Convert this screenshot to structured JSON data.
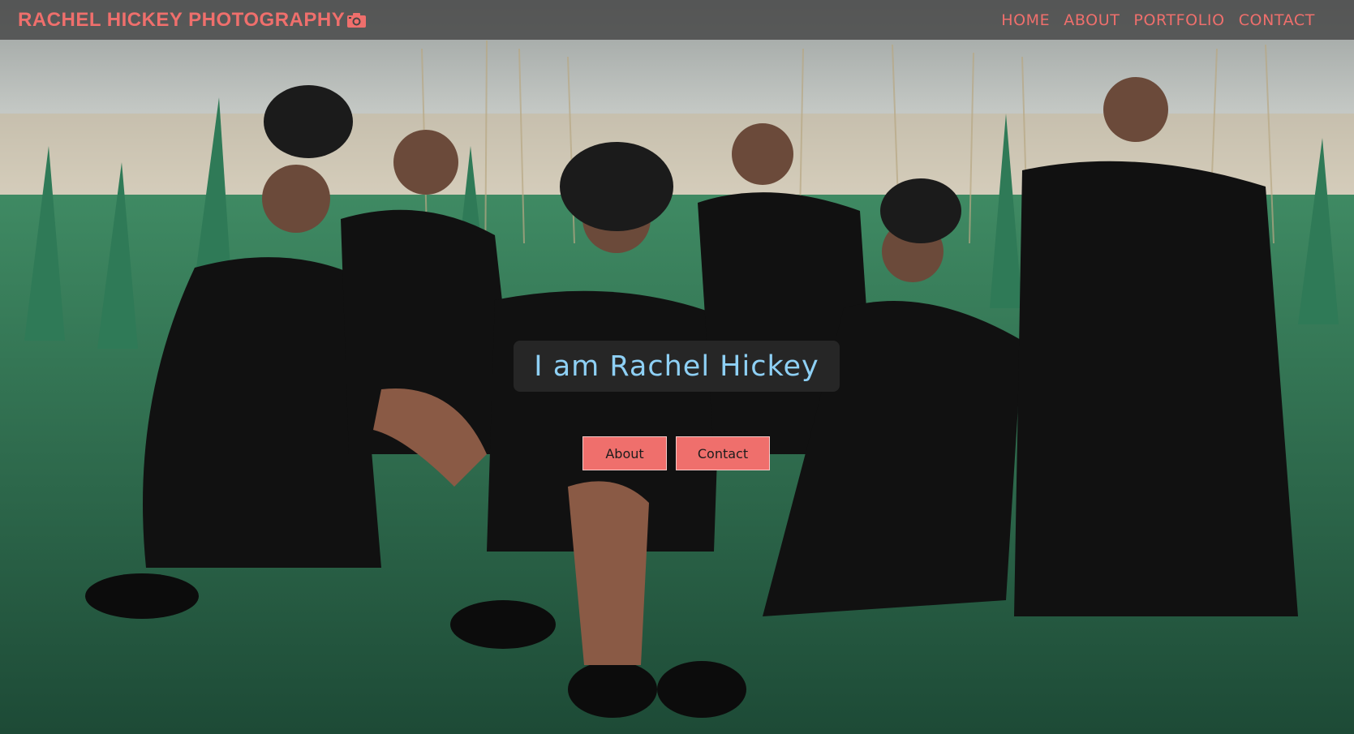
{
  "header": {
    "brand": "RACHEL HICKEY PHOTOGRAPHY",
    "brand_icon": "camera-icon",
    "nav": [
      {
        "label": "HOME"
      },
      {
        "label": "ABOUT"
      },
      {
        "label": "PORTFOLIO"
      },
      {
        "label": "CONTACT"
      }
    ]
  },
  "hero": {
    "title": "I am Rachel Hickey",
    "buttons": {
      "about": "About",
      "contact": "Contact"
    }
  },
  "colors": {
    "accent": "#ef6f6c",
    "title_text": "#8ed0f5",
    "header_bg": "#464646"
  }
}
